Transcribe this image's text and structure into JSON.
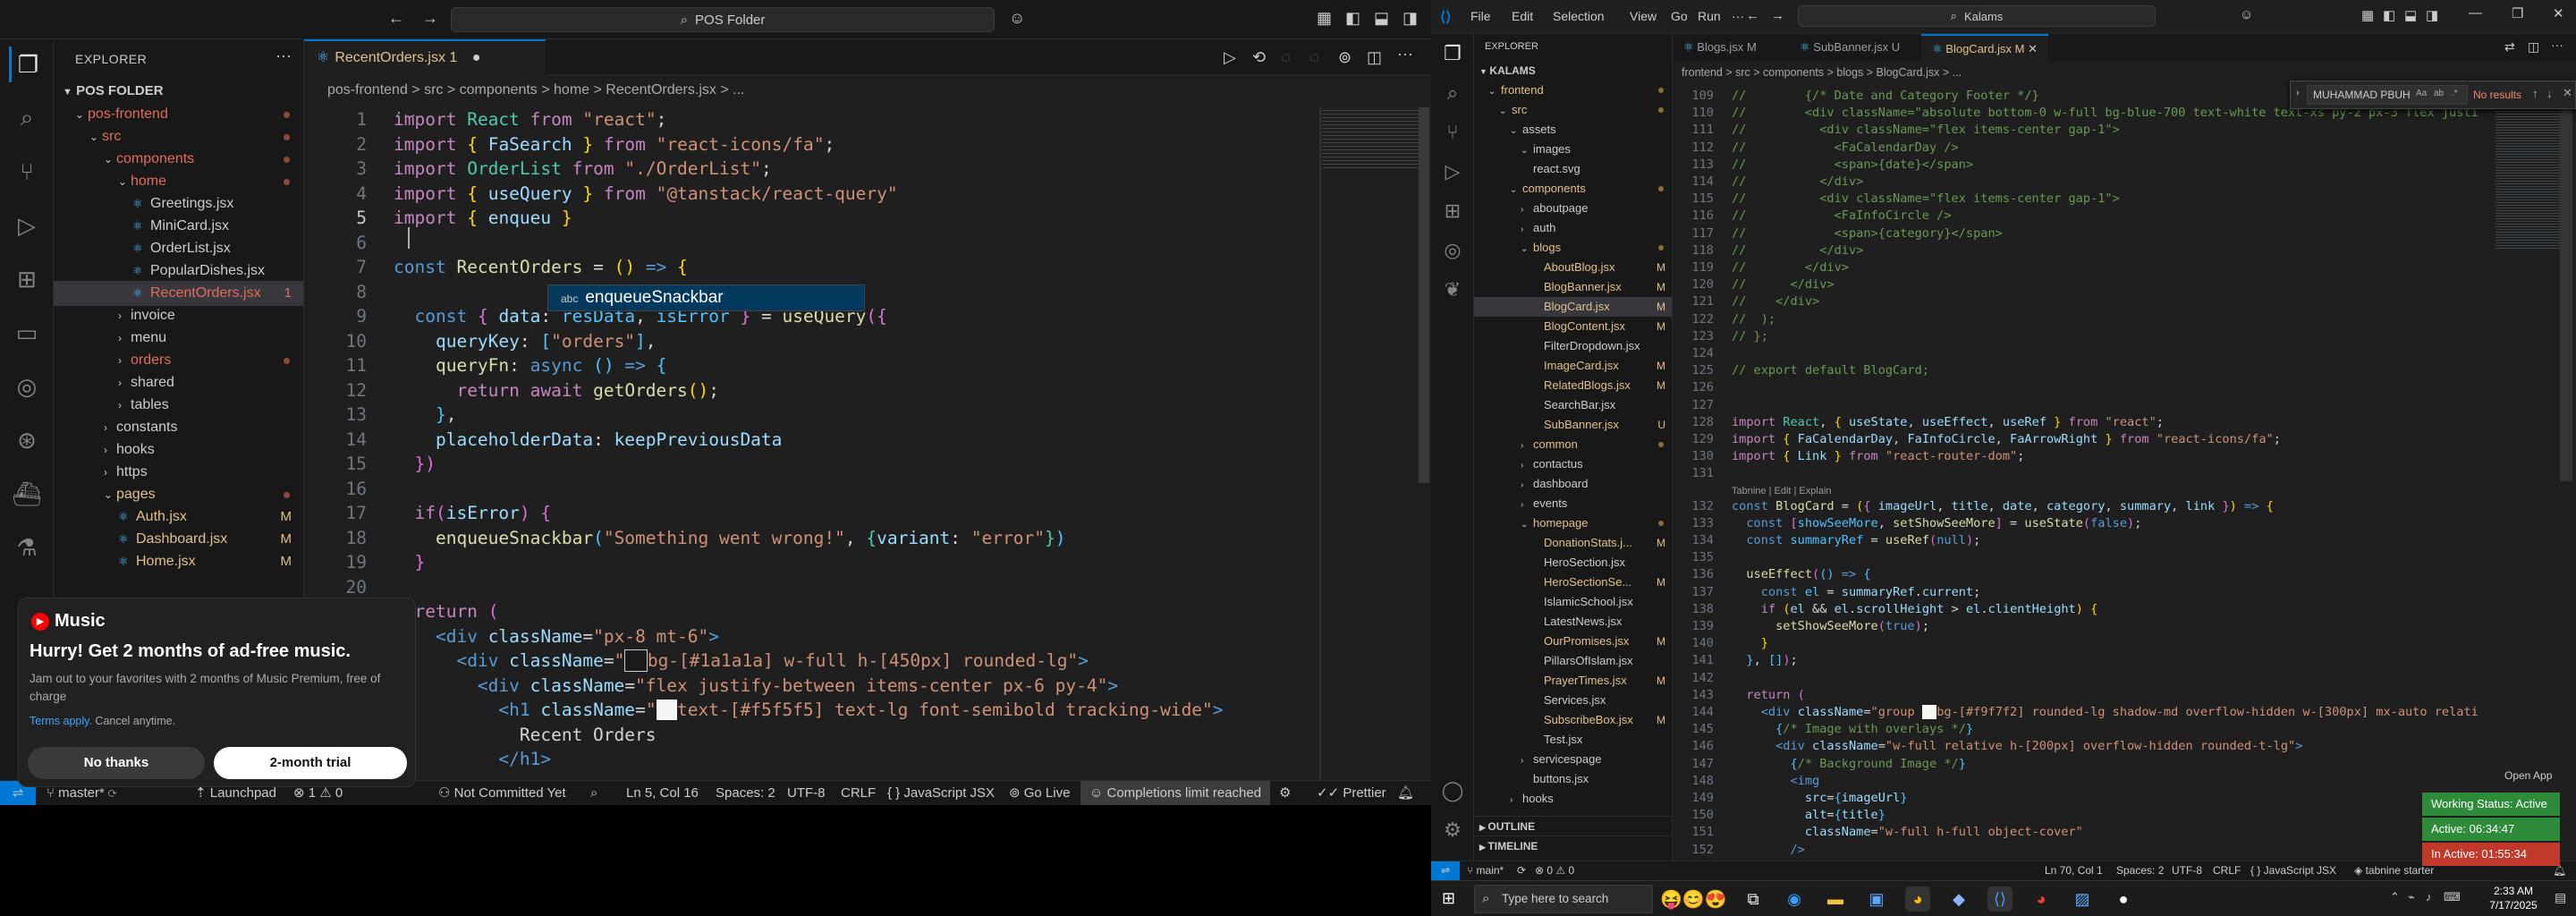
{
  "left": {
    "nav_back": "←",
    "nav_forward": "→",
    "command_center": "POS Folder",
    "search_icon_glyph": "⌕",
    "explorer_title": "EXPLORER",
    "folder_root": "POS FOLDER",
    "tree": [
      {
        "label": "pos-frontend",
        "level": 1,
        "kind": "folder-open",
        "color": "#e06c5c",
        "dot": true
      },
      {
        "label": "src",
        "level": 2,
        "kind": "folder-open",
        "color": "#e06c5c",
        "dot": true
      },
      {
        "label": "components",
        "level": 3,
        "kind": "folder-open",
        "color": "#e06c5c",
        "dot": true
      },
      {
        "label": "home",
        "level": 4,
        "kind": "folder-open",
        "color": "#e06c5c",
        "dot": true
      },
      {
        "label": "Greetings.jsx",
        "level": 5,
        "kind": "file",
        "color": "#ccc"
      },
      {
        "label": "MiniCard.jsx",
        "level": 5,
        "kind": "file",
        "color": "#ccc"
      },
      {
        "label": "OrderList.jsx",
        "level": 5,
        "kind": "file",
        "color": "#ccc"
      },
      {
        "label": "PopularDishes.jsx",
        "level": 5,
        "kind": "file",
        "color": "#ccc"
      },
      {
        "label": "RecentOrders.jsx",
        "level": 5,
        "kind": "file",
        "color": "#e06c5c",
        "badge": "1",
        "selected": true
      },
      {
        "label": "invoice",
        "level": 4,
        "kind": "folder",
        "color": "#ccc"
      },
      {
        "label": "menu",
        "level": 4,
        "kind": "folder",
        "color": "#ccc"
      },
      {
        "label": "orders",
        "level": 4,
        "kind": "folder",
        "color": "#e06c5c",
        "dot": true
      },
      {
        "label": "shared",
        "level": 4,
        "kind": "folder",
        "color": "#ccc"
      },
      {
        "label": "tables",
        "level": 4,
        "kind": "folder",
        "color": "#ccc"
      },
      {
        "label": "constants",
        "level": 3,
        "kind": "folder",
        "color": "#ccc"
      },
      {
        "label": "hooks",
        "level": 3,
        "kind": "folder",
        "color": "#ccc"
      },
      {
        "label": "https",
        "level": 3,
        "kind": "folder",
        "color": "#ccc"
      },
      {
        "label": "pages",
        "level": 3,
        "kind": "folder-open",
        "color": "#e2c08d",
        "dot": true
      },
      {
        "label": "Auth.jsx",
        "level": 4,
        "kind": "file",
        "color": "#e2c08d",
        "badge": "M"
      },
      {
        "label": "Dashboard.jsx",
        "level": 4,
        "kind": "file",
        "color": "#e2c08d",
        "badge": "M"
      },
      {
        "label": "Home.jsx",
        "level": 4,
        "kind": "file",
        "color": "#e2c08d",
        "badge": "M"
      }
    ],
    "tab_label": "RecentOrders.jsx",
    "tab_badge": "1",
    "breadcrumb": "pos-frontend > src > components > home > RecentOrders.jsx > ...",
    "suggestion": "enqueueSnackbar",
    "suggestion_tag": "abc",
    "status": {
      "branch": "master*",
      "launchpad": "Launchpad",
      "problems": "⊗ 1 ⚠ 0",
      "commit": "Not Committed Yet",
      "position": "Ln 5, Col 16",
      "spaces": "Spaces: 2",
      "encoding": "UTF-8",
      "eol": "CRLF",
      "language": "{ } JavaScript JSX",
      "golive": "Go Live",
      "completions": "Completions limit reached",
      "prettier": "Prettier"
    }
  },
  "music_popup": {
    "brand": "Music",
    "headline": "Hurry! Get 2 months of ad-free music.",
    "body": "Jam out to your favorites with 2 months of Music Premium, free of charge",
    "terms": "Terms apply.",
    "cancel": "Cancel anytime.",
    "no_thanks": "No thanks",
    "trial": "2-month trial"
  },
  "right": {
    "menus": [
      "File",
      "Edit",
      "Selection",
      "View",
      "Go",
      "Run",
      "···"
    ],
    "command_center": "Kalams",
    "explorer_title": "EXPLORER",
    "root": "KALAMS",
    "tree": [
      {
        "label": "frontend",
        "level": 1,
        "kind": "folder-open",
        "color": "#e2c08d",
        "dot": true
      },
      {
        "label": "src",
        "level": 2,
        "kind": "folder-open",
        "color": "#e2c08d",
        "dot": true
      },
      {
        "label": "assets",
        "level": 3,
        "kind": "folder-open",
        "color": "#ccc"
      },
      {
        "label": "images",
        "level": 4,
        "kind": "folder-open",
        "color": "#ccc"
      },
      {
        "label": "react.svg",
        "level": 4,
        "kind": "file",
        "color": "#ccc"
      },
      {
        "label": "components",
        "level": 3,
        "kind": "folder-open",
        "color": "#e2c08d",
        "dot": true
      },
      {
        "label": "aboutpage",
        "level": 4,
        "kind": "folder",
        "color": "#ccc"
      },
      {
        "label": "auth",
        "level": 4,
        "kind": "folder",
        "color": "#ccc"
      },
      {
        "label": "blogs",
        "level": 4,
        "kind": "folder-open",
        "color": "#e2c08d",
        "dot": true
      },
      {
        "label": "AboutBlog.jsx",
        "level": 5,
        "kind": "file",
        "color": "#e2c08d",
        "badge": "M"
      },
      {
        "label": "BlogBanner.jsx",
        "level": 5,
        "kind": "file",
        "color": "#e2c08d",
        "badge": "M"
      },
      {
        "label": "BlogCard.jsx",
        "level": 5,
        "kind": "file",
        "color": "#e2c08d",
        "badge": "M",
        "selected": true
      },
      {
        "label": "BlogContent.jsx",
        "level": 5,
        "kind": "file",
        "color": "#e2c08d",
        "badge": "M"
      },
      {
        "label": "FilterDropdown.jsx",
        "level": 5,
        "kind": "file",
        "color": "#ccc"
      },
      {
        "label": "ImageCard.jsx",
        "level": 5,
        "kind": "file",
        "color": "#e2c08d",
        "badge": "M"
      },
      {
        "label": "RelatedBlogs.jsx",
        "level": 5,
        "kind": "file",
        "color": "#e2c08d",
        "badge": "M"
      },
      {
        "label": "SearchBar.jsx",
        "level": 5,
        "kind": "file",
        "color": "#ccc"
      },
      {
        "label": "SubBanner.jsx",
        "level": 5,
        "kind": "file",
        "color": "#e2c08d",
        "badge": "U"
      },
      {
        "label": "common",
        "level": 4,
        "kind": "folder",
        "color": "#e2c08d",
        "dot": true
      },
      {
        "label": "contactus",
        "level": 4,
        "kind": "folder",
        "color": "#ccc"
      },
      {
        "label": "dashboard",
        "level": 4,
        "kind": "folder",
        "color": "#ccc"
      },
      {
        "label": "events",
        "level": 4,
        "kind": "folder",
        "color": "#ccc"
      },
      {
        "label": "homepage",
        "level": 4,
        "kind": "folder-open",
        "color": "#e2c08d",
        "dot": true
      },
      {
        "label": "DonationStats.j...",
        "level": 5,
        "kind": "file",
        "color": "#e2c08d",
        "badge": "M"
      },
      {
        "label": "HeroSection.jsx",
        "level": 5,
        "kind": "file",
        "color": "#ccc"
      },
      {
        "label": "HeroSectionSe...",
        "level": 5,
        "kind": "file",
        "color": "#e2c08d",
        "badge": "M"
      },
      {
        "label": "IslamicSchool.jsx",
        "level": 5,
        "kind": "file",
        "color": "#ccc"
      },
      {
        "label": "LatestNews.jsx",
        "level": 5,
        "kind": "file",
        "color": "#ccc"
      },
      {
        "label": "OurPromises.jsx",
        "level": 5,
        "kind": "file",
        "color": "#e2c08d",
        "badge": "M"
      },
      {
        "label": "PillarsOfIslam.jsx",
        "level": 5,
        "kind": "file",
        "color": "#ccc"
      },
      {
        "label": "PrayerTimes.jsx",
        "level": 5,
        "kind": "file",
        "color": "#e2c08d",
        "badge": "M"
      },
      {
        "label": "Services.jsx",
        "level": 5,
        "kind": "file",
        "color": "#ccc"
      },
      {
        "label": "SubscribeBox.jsx",
        "level": 5,
        "kind": "file",
        "color": "#e2c08d",
        "badge": "M"
      },
      {
        "label": "Test.jsx",
        "level": 5,
        "kind": "file",
        "color": "#ccc"
      },
      {
        "label": "servicespage",
        "level": 4,
        "kind": "folder",
        "color": "#ccc"
      },
      {
        "label": "buttons.jsx",
        "level": 4,
        "kind": "file",
        "color": "#ccc"
      },
      {
        "label": "hooks",
        "level": 3,
        "kind": "folder",
        "color": "#ccc"
      }
    ],
    "outline": "OUTLINE",
    "timeline": "TIMELINE",
    "tabs": [
      {
        "label": "Blogs.jsx",
        "badge": "M"
      },
      {
        "label": "SubBanner.jsx",
        "badge": "U"
      },
      {
        "label": "BlogCard.jsx",
        "badge": "M",
        "active": true
      }
    ],
    "breadcrumb": "frontend > src > components > blogs > BlogCard.jsx > ...",
    "find_value": "MUHAMMAD PBUH",
    "find_result": "No results",
    "codelens": "Tabnine | Edit | Explain",
    "open_app": "Open App",
    "status": {
      "branch": "main*",
      "problems": "⊗ 0 ⚠ 0",
      "position": "Ln 70, Col 1",
      "spaces": "Spaces: 2",
      "encoding": "UTF-8",
      "eol": "CRLF",
      "language": "{ } JavaScript JSX",
      "tabnine": "tabnine starter"
    },
    "work_status": "Working Status: Active",
    "active_time": "Active: 06:34:47",
    "inactive_time": "In Active: 01:55:34"
  },
  "taskbar": {
    "search": "Type here to search",
    "time": "2:33 AM",
    "date": "7/17/2025"
  },
  "colors": {
    "accent": "#0078d4",
    "git_modified": "#e2c08d",
    "error": "#e06c5c"
  }
}
